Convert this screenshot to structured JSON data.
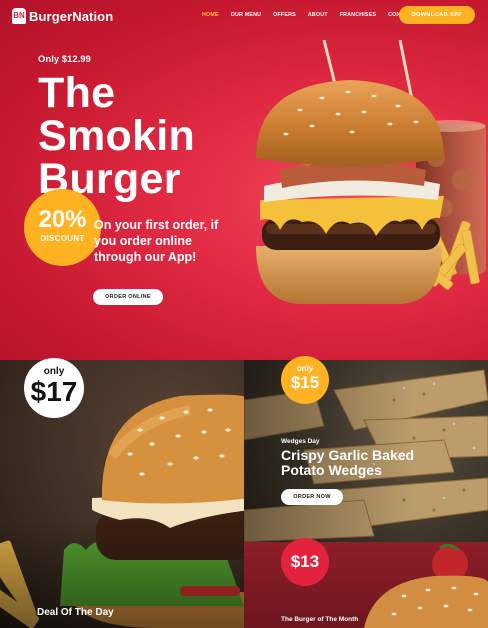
{
  "brand": {
    "name": "BurgerNation",
    "mark": "BN"
  },
  "nav": {
    "links": [
      "HOME",
      "OUR MENU",
      "OFFERS",
      "ABOUT",
      "FRANCHISES",
      "CONTACT"
    ],
    "active": "HOME",
    "cta": "DOWNLOAD APP"
  },
  "hero": {
    "price_line": "Only $12.99",
    "title_lines": [
      "The",
      "Smokin",
      "Burger"
    ],
    "discount_value": "20%",
    "discount_label": "DISCOUNT",
    "promo_text": "On your first order, if you order online through our App!",
    "cta": "ORDER ONLINE"
  },
  "deal": {
    "badge_top": "only",
    "badge_price": "$17",
    "title": "Deal Of The Day"
  },
  "wedges": {
    "badge_top": "only",
    "badge_price": "$15",
    "tag": "Wedges Day",
    "title": "Crispy Garlic Baked Potato Wedges",
    "cta": "ORDER NOW"
  },
  "month": {
    "badge_price": "$13",
    "title": "The Burger of The Month"
  },
  "colors": {
    "brand_red": "#e02a43",
    "accent_yellow": "#ffb322",
    "active_nav": "#ffc23d"
  }
}
